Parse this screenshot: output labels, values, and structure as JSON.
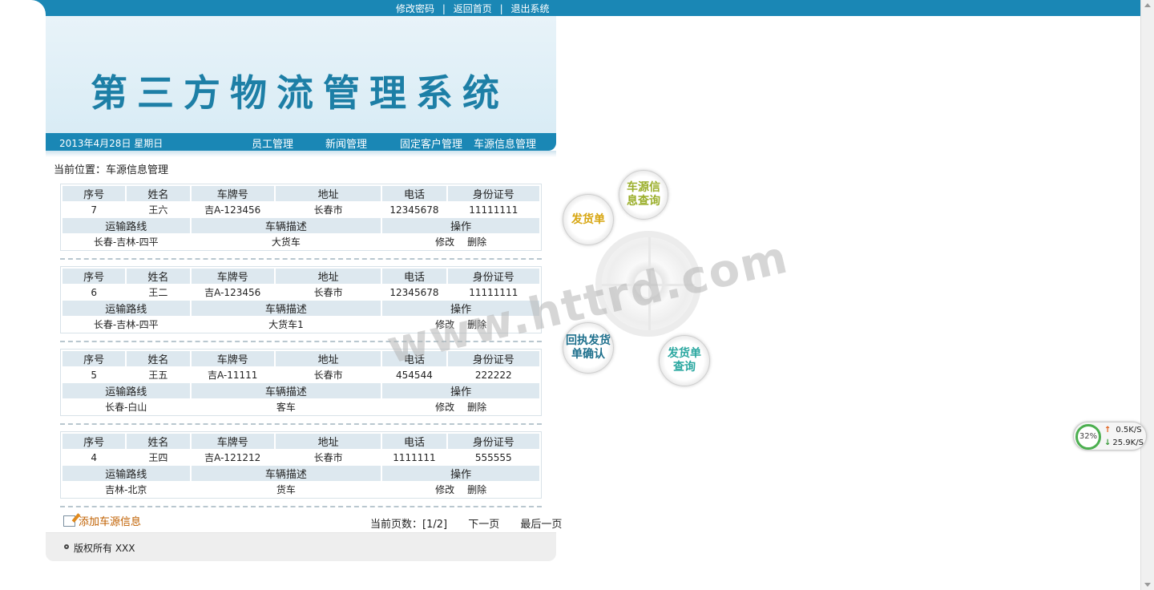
{
  "top_links": [
    "修改密码",
    "返回首页",
    "退出系统"
  ],
  "top_sep": "|",
  "banner_title": "第三方物流管理系统",
  "nav": {
    "date": "2013年4月28日 星期日",
    "items": [
      "员工管理",
      "新闻管理",
      "固定客户管理",
      "车源信息管理"
    ]
  },
  "breadcrumb": "当前位置：车源信息管理",
  "headers": {
    "no": "序号",
    "name": "姓名",
    "plate": "车牌号",
    "address": "地址",
    "phone": "电话",
    "id": "身份证号",
    "route": "运输路线",
    "desc": "车辆描述",
    "ops": "操作"
  },
  "actions": {
    "edit": "修改",
    "delete": "删除"
  },
  "records": [
    {
      "no": "7",
      "name": "王六",
      "plate": "吉A-123456",
      "address": "长春市",
      "phone": "12345678",
      "id": "11111111",
      "route": "长春-吉林-四平",
      "desc": "大货车"
    },
    {
      "no": "6",
      "name": "王二",
      "plate": "吉A-123456",
      "address": "长春市",
      "phone": "12345678",
      "id": "11111111",
      "route": "长春-吉林-四平",
      "desc": "大货车1"
    },
    {
      "no": "5",
      "name": "王五",
      "plate": "吉A-11111",
      "address": "长春市",
      "phone": "454544",
      "id": "222222",
      "route": "长春-白山",
      "desc": "客车"
    },
    {
      "no": "4",
      "name": "王四",
      "plate": "吉A-121212",
      "address": "长春市",
      "phone": "1111111",
      "id": "555555",
      "route": "吉林-北京",
      "desc": "货车"
    }
  ],
  "add_link": "添加车源信息",
  "pager": {
    "label": "当前页数：[1/2]",
    "next": "下一页",
    "last": "最后一页"
  },
  "footer": "版权所有 XXX",
  "flow": {
    "car_query": "车源信息查询",
    "invoice": "发货单",
    "receipt_confirm": "回执发货单确认",
    "invoice_query": "发货单查询",
    "colors": {
      "car_query": "#9aae2a",
      "invoice": "#d7a50f",
      "receipt_confirm": "#1d6f8c",
      "invoice_query": "#2aa7a0"
    }
  },
  "watermark": "www.httrd.com",
  "net": {
    "percent": "32%",
    "up": "0.5K/S",
    "down": "25.9K/S"
  }
}
